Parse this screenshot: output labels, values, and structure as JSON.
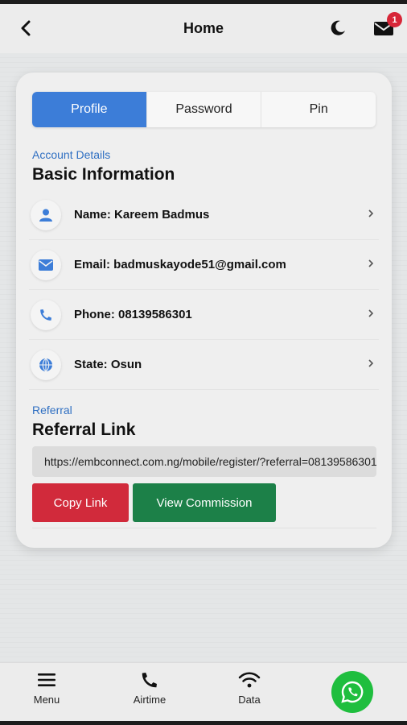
{
  "header": {
    "title": "Home",
    "notification_count": "1"
  },
  "tabs": [
    {
      "label": "Profile",
      "active": true
    },
    {
      "label": "Password",
      "active": false
    },
    {
      "label": "Pin",
      "active": false
    }
  ],
  "account": {
    "kicker": "Account Details",
    "title": "Basic Information",
    "rows": [
      {
        "icon": "user-icon",
        "text": "Name: Kareem Badmus"
      },
      {
        "icon": "envelope-icon",
        "text": "Email: badmuskayode51@gmail.com"
      },
      {
        "icon": "phone-icon",
        "text": "Phone: 08139586301"
      },
      {
        "icon": "globe-icon",
        "text": "State: Osun"
      }
    ]
  },
  "referral": {
    "kicker": "Referral",
    "title": "Referral Link",
    "link": "https://embconnect.com.ng/mobile/register/?referral=08139586301",
    "copy_label": "Copy Link",
    "commission_label": "View Commission"
  },
  "bottom_nav": {
    "items": [
      {
        "label": "Menu",
        "icon": "menu-icon"
      },
      {
        "label": "Airtime",
        "icon": "phone-icon"
      },
      {
        "label": "Data",
        "icon": "wifi-icon"
      }
    ],
    "whatsapp_icon": "whatsapp-icon"
  },
  "colors": {
    "primary": "#3c7dd8",
    "danger": "#d12a3b",
    "success": "#1c8048",
    "whatsapp": "#1fbe3e"
  }
}
